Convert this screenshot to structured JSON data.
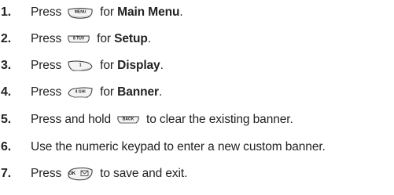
{
  "steps": [
    {
      "number": "1.",
      "before": "Press",
      "key": "MENU",
      "key_icon": "menu-key-icon",
      "after": "for",
      "target": "Main Menu",
      "end": "."
    },
    {
      "number": "2.",
      "before": "Press",
      "key": "8 TUV",
      "key_icon": "key-8-icon",
      "after": "for",
      "target": "Setup",
      "end": "."
    },
    {
      "number": "3.",
      "before": "Press",
      "key": "1",
      "key_icon": "key-1-icon",
      "after": "for",
      "target": "Display",
      "end": "."
    },
    {
      "number": "4.",
      "before": "Press",
      "key": "4 GHI",
      "key_icon": "key-4-icon",
      "after": "for",
      "target": "Banner",
      "end": "."
    },
    {
      "number": "5.",
      "before": "Press and hold",
      "key": "BACK",
      "key_icon": "back-key-icon",
      "after": "to clear the existing banner."
    },
    {
      "number": "6.",
      "text": "Use the numeric keypad to enter a new custom banner."
    },
    {
      "number": "7.",
      "before": "Press",
      "key": "OK",
      "key_icon": "ok-key-icon",
      "after": "to save and exit."
    }
  ]
}
